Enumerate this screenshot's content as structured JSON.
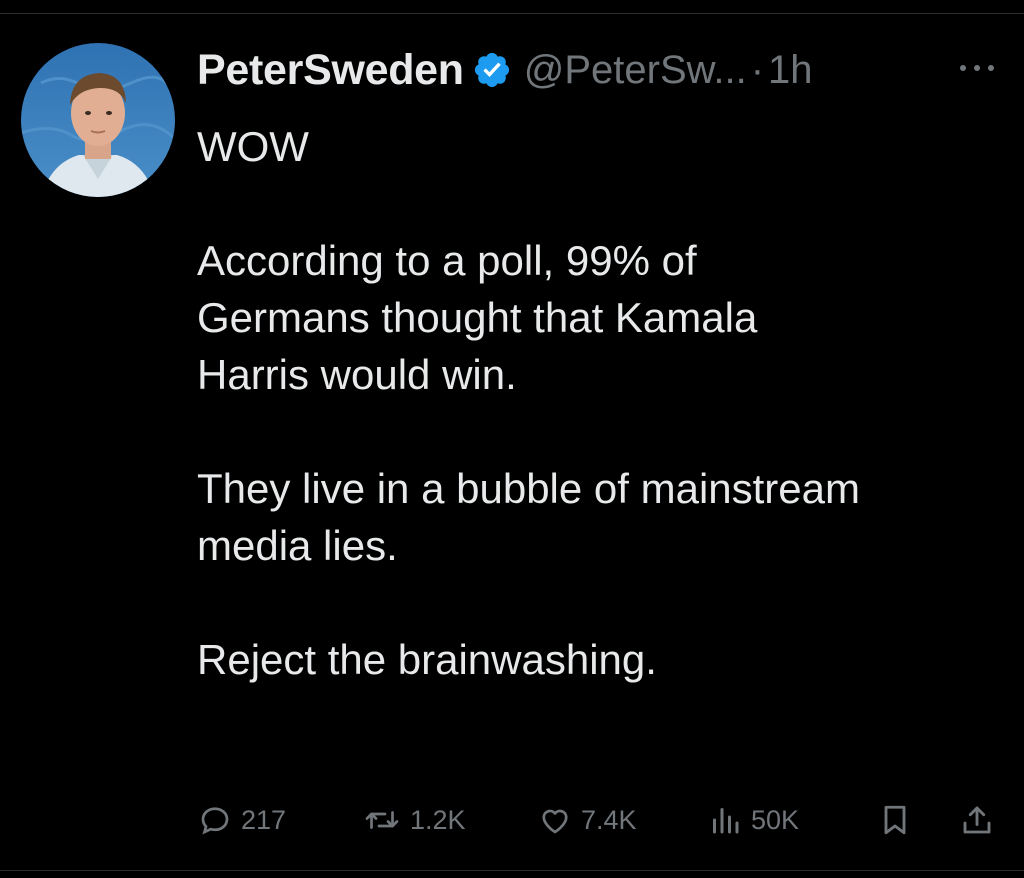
{
  "post": {
    "author": {
      "display_name": "PeterSweden",
      "handle": "@PeterSw...",
      "verified_icon": "verified-badge-icon",
      "avatar": "profile-photo"
    },
    "separator": "·",
    "time": "1h",
    "more_icon": "more-horizontal-icon",
    "paragraphs": [
      "WOW",
      "According to a poll, 99% of\nGermans thought that Kamala\nHarris would win.",
      "They live in a bubble of mainstream\nmedia lies.",
      "Reject the brainwashing."
    ],
    "actions": {
      "reply": {
        "icon": "reply-icon",
        "count": "217"
      },
      "repost": {
        "icon": "repost-icon",
        "count": "1.2K"
      },
      "like": {
        "icon": "heart-icon",
        "count": "7.4K"
      },
      "views": {
        "icon": "views-chart-icon",
        "count": "50K"
      },
      "bookmark": {
        "icon": "bookmark-icon"
      },
      "share": {
        "icon": "share-icon"
      }
    }
  },
  "colors": {
    "background": "#000000",
    "text": "#e7e9ea",
    "muted": "#71767b",
    "verified": "#1d9bf0"
  }
}
